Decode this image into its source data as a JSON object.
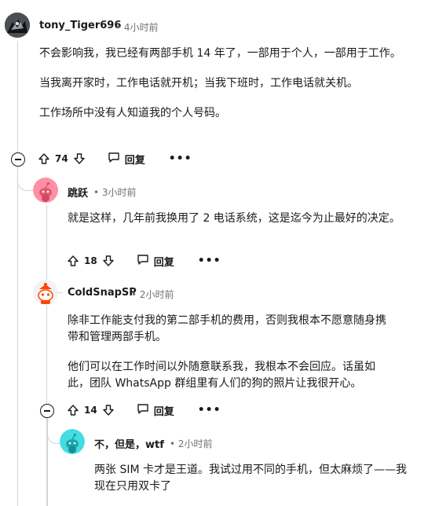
{
  "comments": [
    {
      "author": "tony_Tiger696",
      "sep": "•",
      "time": "4小时前",
      "paragraphs": [
        "不会影响我，我已经有两部手机 14 年了，一部用于个人，一部用于工作。",
        "当我离开家时，工作电话就开机；当我下班时，工作电话就关机。",
        "工作场所中没有人知道我的个人号码。"
      ],
      "votes": "74",
      "reply_label": "回复",
      "more_label": "•••"
    },
    {
      "author": "跳跃",
      "sep": "•",
      "time": "3小时前",
      "paragraphs": [
        "就是这样，几年前我换用了 2 电话系统，这是迄今为止最好的决定。"
      ],
      "votes": "18",
      "reply_label": "回复",
      "more_label": "•••"
    },
    {
      "author": "ColdSnapSP",
      "sep": "•",
      "time": "2小时前",
      "paragraphs": [
        "除非工作能支付我的第二部手机的费用，否则我根本不愿意随身携带和管理两部手机。",
        "他们可以在工作时间以外随意联系我，我根本不会回应。话虽如此，团队 WhatsApp 群组里有人们的狗的照片让我很开心。"
      ],
      "votes": "14",
      "reply_label": "回复",
      "more_label": "•••"
    },
    {
      "author": "不，但是，wtf",
      "sep": "•",
      "time": "2小时前",
      "paragraphs": [
        "两张 SIM 卡才是王道。我试过用不同的手机，但太麻烦了——我现在只用双卡了"
      ]
    }
  ],
  "colors": {
    "avatar_pink": "#ff8fa3",
    "avatar_red": "#ff4500",
    "avatar_teal": "#44dde2",
    "line": "#d0d5da",
    "meta": "#6b7075"
  },
  "icons": {
    "upvote": "arrow-up-icon",
    "downvote": "arrow-down-icon",
    "reply": "speech-bubble-icon",
    "collapse": "minus-circle-icon"
  }
}
